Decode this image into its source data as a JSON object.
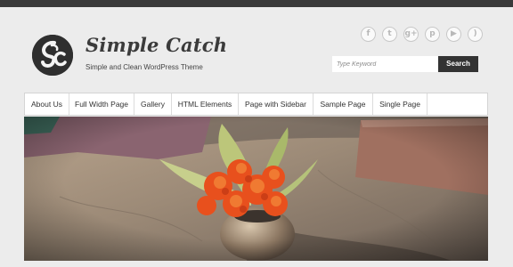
{
  "site": {
    "title": "Simple Catch",
    "tagline": "Simple and Clean WordPress Theme"
  },
  "social_icons": [
    "facebook-icon",
    "twitter-icon",
    "google-plus-icon",
    "pinterest-icon",
    "youtube-icon",
    "rss-icon"
  ],
  "search": {
    "placeholder": "Type Keyword",
    "button_label": "Search"
  },
  "nav": {
    "items": [
      {
        "label": "About Us"
      },
      {
        "label": "Full Width Page"
      },
      {
        "label": "Gallery"
      },
      {
        "label": "HTML Elements"
      },
      {
        "label": "Page with Sidebar"
      },
      {
        "label": "Sample Page"
      },
      {
        "label": "Single Page"
      }
    ]
  },
  "colors": {
    "background": "#ececec",
    "topbar": "#3a3a3a",
    "accent_dark": "#333333",
    "flower_orange": "#e8501d"
  }
}
